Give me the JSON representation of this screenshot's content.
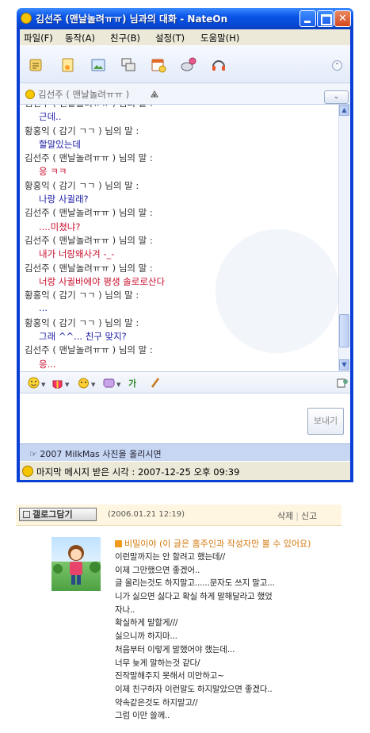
{
  "window": {
    "title": "김선주 (맨날놀려ㅠㅠ) 님과의 대화  - NateOn",
    "minimize_label": "",
    "maximize_label": "",
    "close_label": "✕"
  },
  "menu": {
    "items": [
      "파일(F)",
      "동작(A)",
      "친구(B)",
      "설정(T)",
      "도움말(H)"
    ]
  },
  "toolbar": {
    "tools": [
      "file-send-icon",
      "file-share-icon",
      "photo-icon",
      "share-screen-icon",
      "schedule-icon",
      "voice-chat-icon",
      "headset-icon"
    ],
    "collapse_label": "⌃"
  },
  "peer": {
    "name": "김선주 ( 맨날놀려ㅠㅠ )",
    "dropdown_label": "⌄"
  },
  "chat": {
    "lines": [
      {
        "kind": "speaker",
        "text": "김선주 ( 맨날놀려ㅠㅠ ) 님의 말 :"
      },
      {
        "kind": "me",
        "text": "근데.."
      },
      {
        "kind": "speaker",
        "text": "황홍익 ( 감기 ㄱㄱ ) 님의 말 :"
      },
      {
        "kind": "me",
        "text": "할말있는데"
      },
      {
        "kind": "speaker",
        "text": "김선주 ( 맨날놀려ㅠㅠ ) 님의 말 :"
      },
      {
        "kind": "peer",
        "text": "응 ㅋㅋ"
      },
      {
        "kind": "speaker",
        "text": "황홍익 ( 감기 ㄱㄱ ) 님의 말 :"
      },
      {
        "kind": "me",
        "text": "나랑 사귈래?"
      },
      {
        "kind": "speaker",
        "text": "김선주 ( 맨날놀려ㅠㅠ ) 님의 말 :"
      },
      {
        "kind": "peer",
        "text": "....미쳤냐?"
      },
      {
        "kind": "speaker",
        "text": "김선주 ( 맨날놀려ㅠㅠ ) 님의 말 :"
      },
      {
        "kind": "peer",
        "text": "내가 너랑왜사겨 -_-"
      },
      {
        "kind": "speaker",
        "text": "김선주 ( 맨날놀려ㅠㅠ ) 님의 말 :"
      },
      {
        "kind": "peer",
        "text": "너랑 사귈바에야 평생 솔로로산다"
      },
      {
        "kind": "speaker",
        "text": "황홍익 ( 감기 ㄱㄱ ) 님의 말 :"
      },
      {
        "kind": "me",
        "text": "..."
      },
      {
        "kind": "speaker",
        "text": "황홍익 ( 감기 ㄱㄱ ) 님의 말 :"
      },
      {
        "kind": "me",
        "text": "그래 ^^... 친구 맞지?"
      },
      {
        "kind": "speaker",
        "text": "김선주 ( 맨날놀려ㅠㅠ ) 님의 말 :"
      },
      {
        "kind": "peer",
        "text": "응..."
      }
    ]
  },
  "emoticons": [
    "smiley-icon",
    "gift-icon",
    "sticker-icon",
    "font-color-icon",
    "text-style-icon",
    "brush-icon"
  ],
  "input": {
    "value": "",
    "send_label": "보내기"
  },
  "notice": {
    "text": "☞ 2007 MilkMas 사진을 올리시면"
  },
  "status": {
    "text": "마지막 메시지 받은 시각 : 2007-12-25 오후 09:39"
  },
  "guestbook": {
    "collect_label": "갤로그담기",
    "date": "(2006.01.21 12:19)",
    "delete_label": "삭제",
    "report_label": "신고",
    "secret_label": "비밀이야 (이 글은 홈주인과 작성자만 볼 수 있어요)",
    "lines": [
      "이런말까지는 안 할려고 했는데//",
      "이제 그만했으면 좋겠어..",
      "글 올리는것도 하지말고......문자도 쓰지 말고...",
      "니가 싫으면 싫다고 확실 하게 말해달라고 했었",
      "자나..",
      "확실하게 말할게///",
      "싫으니까 하지마...",
      "처음부터 이렇게 말했어야 했는데...",
      "너무 늦게 말하는것 같다/",
      "진작말해주지 못해서 미안하고~",
      "이제 친구하자 이런말도 하지말았으면 좋겠다..",
      "약속같은것도 하지말고//",
      "그럼 이만 쓸께.."
    ]
  },
  "colors": {
    "titlebar": "#0a55e8",
    "me_text": "#1a1aa6",
    "peer_text": "#c8102e",
    "secret_text": "#d4780c",
    "guestbook_header": "#fff6e1"
  }
}
